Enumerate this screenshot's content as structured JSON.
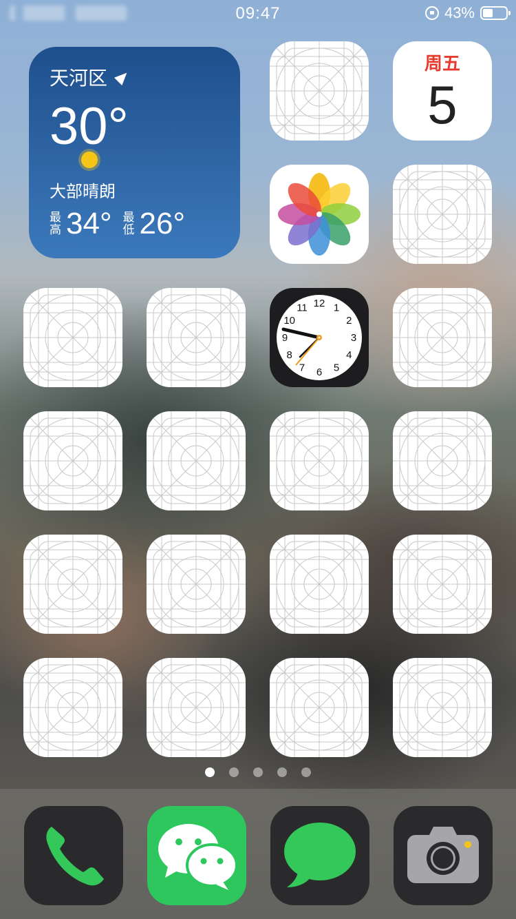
{
  "status_bar": {
    "time": "09:47",
    "battery": "43%"
  },
  "weather": {
    "city": "天河区",
    "temperature": "30°",
    "condition": "大部晴朗",
    "high_label": "最高",
    "high": "34°",
    "low_label": "最低",
    "low": "26°"
  },
  "calendar": {
    "weekday": "周五",
    "day": "5"
  },
  "clock": {
    "numbers": [
      "12",
      "1",
      "2",
      "3",
      "4",
      "5",
      "6",
      "7",
      "8",
      "9",
      "10",
      "11"
    ]
  },
  "page_dots": {
    "count": 5,
    "active": 0
  },
  "colors": {
    "accent_red": "#e63b2e",
    "wechat_green": "#2dc75d",
    "phone_green": "#34c759"
  }
}
